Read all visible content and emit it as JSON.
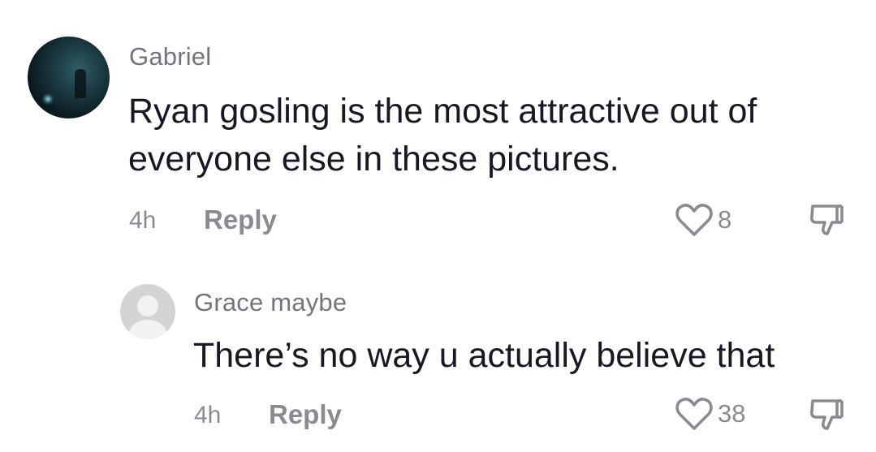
{
  "comments": [
    {
      "username": "Gabriel",
      "text_line1": "Ryan gosling is the most attractive out of",
      "text_line2": "everyone else in these pictures.",
      "time": "4h",
      "reply_label": "Reply",
      "likes": "8",
      "avatar": "user-photo"
    },
    {
      "username": "Grace maybe",
      "text_line1": "There’s no way u actually believe that",
      "time": "4h",
      "reply_label": "Reply",
      "likes": "38",
      "avatar": "default-avatar"
    }
  ],
  "icons": {
    "like": "heart-outline-icon",
    "dislike": "thumbs-down-outline-icon"
  },
  "colors": {
    "text": "#161823",
    "muted": "#8a8b91",
    "username": "#737480",
    "background": "#ffffff"
  }
}
